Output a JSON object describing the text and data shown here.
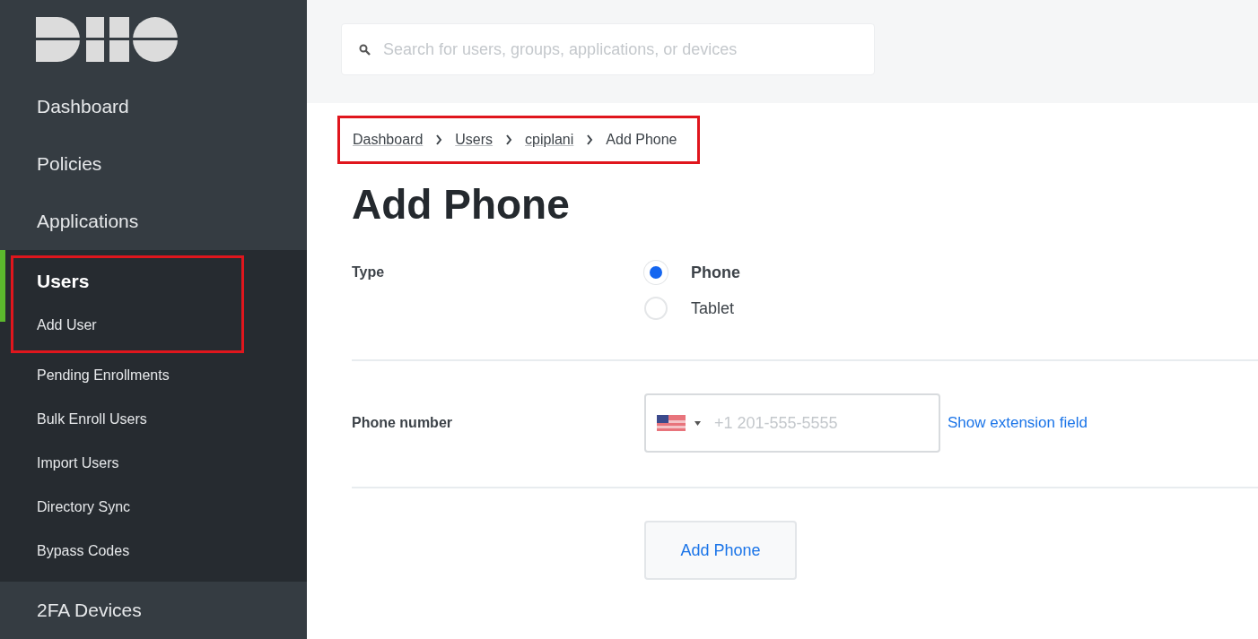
{
  "sidebar": {
    "nav": [
      {
        "label": "Dashboard",
        "selected": false
      },
      {
        "label": "Policies",
        "selected": false
      },
      {
        "label": "Applications",
        "selected": false
      },
      {
        "label": "Users",
        "selected": true,
        "highlighted": true,
        "children": [
          {
            "label": "Add User",
            "highlighted": true
          },
          {
            "label": "Pending Enrollments",
            "highlighted": false
          },
          {
            "label": "Bulk Enroll Users",
            "highlighted": false
          },
          {
            "label": "Import Users",
            "highlighted": false
          },
          {
            "label": "Directory Sync",
            "highlighted": false
          },
          {
            "label": "Bypass Codes",
            "highlighted": false
          }
        ]
      },
      {
        "label": "2FA Devices",
        "selected": false
      }
    ]
  },
  "search": {
    "placeholder": "Search for users, groups, applications, or devices"
  },
  "breadcrumb": {
    "highlighted": true,
    "items": [
      {
        "label": "Dashboard",
        "kind": "link"
      },
      {
        "label": "Users",
        "kind": "link"
      },
      {
        "label": "cpiplani",
        "kind": "link"
      },
      {
        "label": "Add Phone",
        "kind": "current"
      }
    ]
  },
  "title": "Add Phone",
  "type_field": {
    "label": "Type",
    "options": [
      {
        "label": "Phone",
        "selected": true
      },
      {
        "label": "Tablet",
        "selected": false
      }
    ]
  },
  "phone_field": {
    "label": "Phone number",
    "placeholder": "+1 201-555-5555",
    "link": "Show extension field"
  },
  "submit": "Add Phone"
}
